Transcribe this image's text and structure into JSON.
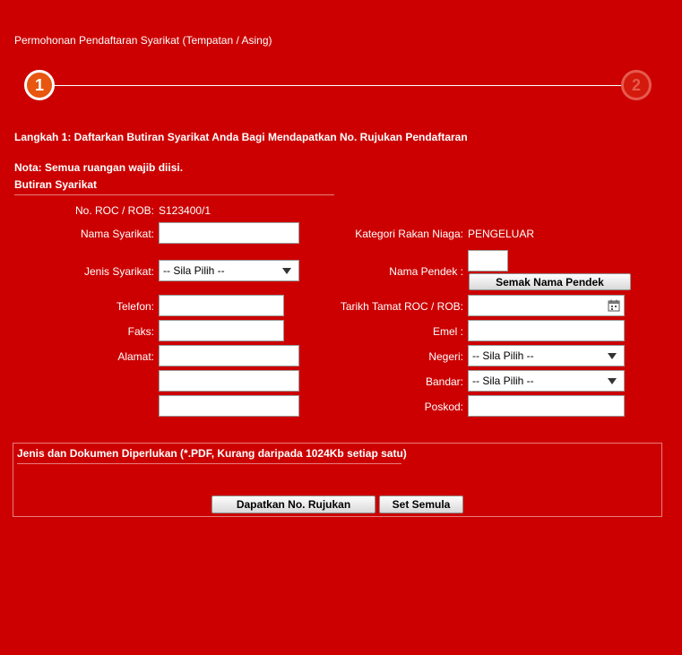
{
  "page_title": "Permohonan Pendaftaran Syarikat (Tempatan / Asing)",
  "steps": {
    "step1": "1",
    "step2": "2"
  },
  "instruction": "Langkah 1: Daftarkan Butiran Syarikat Anda Bagi Mendapatkan No. Rujukan Pendaftaran",
  "note": "Nota: Semua ruangan wajib diisi.",
  "section_title": "Butiran Syarikat",
  "form": {
    "roc_label": "No. ROC / ROB:",
    "roc_value": "S123400/1",
    "nama_label": "Nama Syarikat:",
    "nama_value": "",
    "kategori_label": "Kategori Rakan Niaga:",
    "kategori_value": "PENGELUAR",
    "jenis_label": "Jenis Syarikat:",
    "jenis_value": "-- Sila Pilih --",
    "pendek_label": "Nama Pendek :",
    "pendek_value": "",
    "semak_button": "Semak Nama Pendek",
    "telefon_label": "Telefon:",
    "tarikh_label": "Tarikh Tamat ROC / ROB:",
    "faks_label": "Faks:",
    "emel_label": "Emel :",
    "alamat_label": "Alamat:",
    "negeri_label": "Negeri:",
    "negeri_value": "-- Sila Pilih --",
    "bandar_label": "Bandar:",
    "bandar_value": "-- Sila Pilih --",
    "poskod_label": "Poskod:"
  },
  "documents": {
    "title": "Jenis dan Dokumen Diperlukan (*.PDF, Kurang daripada 1024Kb setiap satu)",
    "submit_button": "Dapatkan No. Rujukan",
    "reset_button": "Set Semula"
  },
  "icons": {
    "calendar": "calendar-icon",
    "dropdown": "chevron-down-icon"
  },
  "colors": {
    "background": "#cc0000",
    "step_active": "#e8560f"
  }
}
